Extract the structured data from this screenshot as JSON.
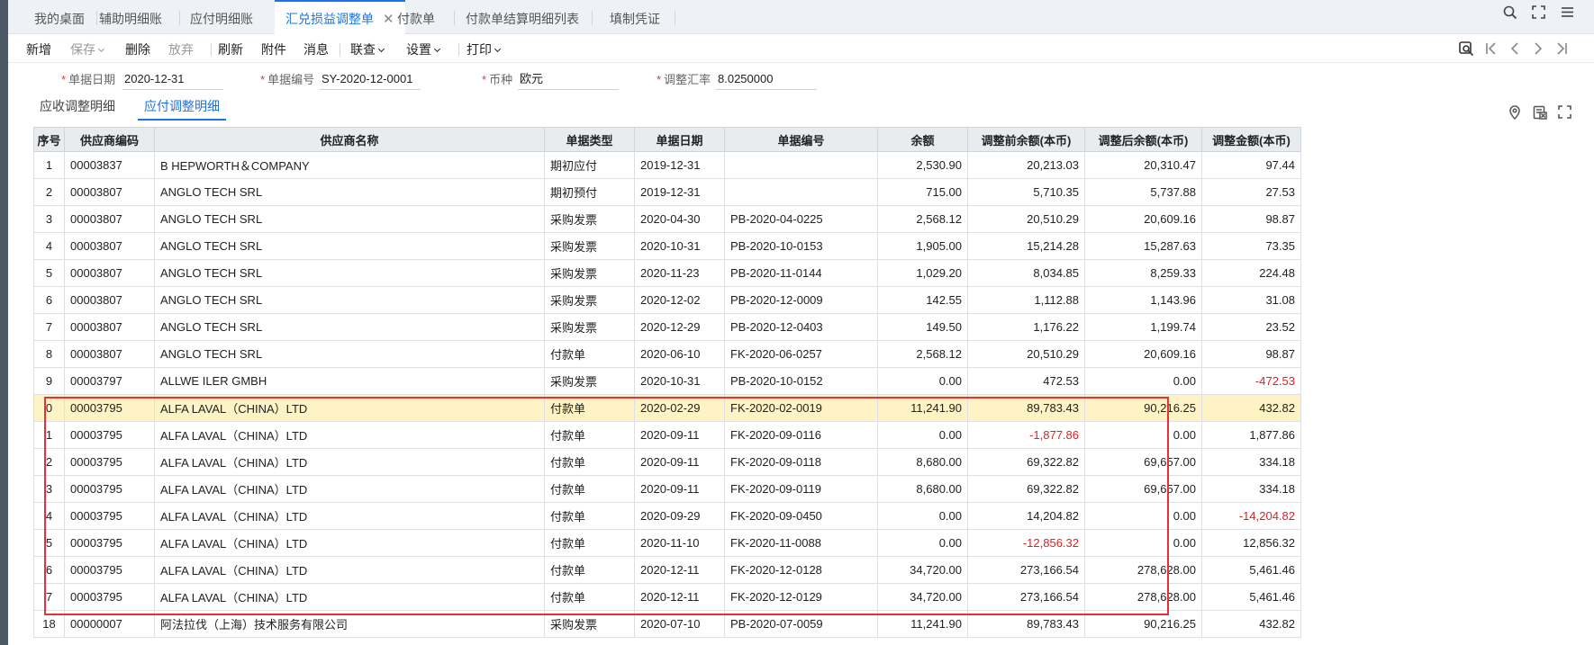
{
  "tabs": [
    {
      "label": "我的桌面"
    },
    {
      "label": "辅助明细账"
    },
    {
      "label": "应付明细账"
    },
    {
      "label": "汇兑损益调整单"
    },
    {
      "label": "付款单"
    },
    {
      "label": "付款单结算明细列表"
    },
    {
      "label": "填制凭证"
    }
  ],
  "toolbar": {
    "new": "新增",
    "save": "保存",
    "delete": "删除",
    "discard": "放弃",
    "refresh": "刷新",
    "attach": "附件",
    "message": "消息",
    "query": "联查",
    "settings": "设置",
    "print": "打印"
  },
  "form": {
    "date_label": "单据日期",
    "date_value": "2020-12-31",
    "no_label": "单据编号",
    "no_value": "SY-2020-12-0001",
    "currency_label": "币种",
    "currency_value": "欧元",
    "rate_label": "调整汇率",
    "rate_value": "8.0250000"
  },
  "subtabs": [
    {
      "label": "应收调整明细"
    },
    {
      "label": "应付调整明细"
    }
  ],
  "table": {
    "headers": [
      "序号",
      "供应商编码",
      "供应商名称",
      "单据类型",
      "单据日期",
      "单据编号",
      "余额",
      "调整前余额(本币)",
      "调整后余额(本币)",
      "调整金额(本币)"
    ],
    "rows": [
      [
        "1",
        "00003837",
        "B HEPWORTH＆COMPANY",
        "期初应付",
        "2019-12-31",
        "",
        "2,530.90",
        "20,213.03",
        "20,310.47",
        "97.44"
      ],
      [
        "2",
        "00003807",
        "ANGLO TECH SRL",
        "期初预付",
        "2019-12-31",
        "",
        "715.00",
        "5,710.35",
        "5,737.88",
        "27.53"
      ],
      [
        "3",
        "00003807",
        "ANGLO TECH SRL",
        "采购发票",
        "2020-04-30",
        "PB-2020-04-0225",
        "2,568.12",
        "20,510.29",
        "20,609.16",
        "98.87"
      ],
      [
        "4",
        "00003807",
        "ANGLO TECH SRL",
        "采购发票",
        "2020-10-31",
        "PB-2020-10-0153",
        "1,905.00",
        "15,214.28",
        "15,287.63",
        "73.35"
      ],
      [
        "5",
        "00003807",
        "ANGLO TECH SRL",
        "采购发票",
        "2020-11-23",
        "PB-2020-11-0144",
        "1,029.20",
        "8,034.85",
        "8,259.33",
        "224.48"
      ],
      [
        "6",
        "00003807",
        "ANGLO TECH SRL",
        "采购发票",
        "2020-12-02",
        "PB-2020-12-0009",
        "142.55",
        "1,112.88",
        "1,143.96",
        "31.08"
      ],
      [
        "7",
        "00003807",
        "ANGLO TECH SRL",
        "采购发票",
        "2020-12-29",
        "PB-2020-12-0403",
        "149.50",
        "1,176.22",
        "1,199.74",
        "23.52"
      ],
      [
        "8",
        "00003807",
        "ANGLO TECH SRL",
        "付款单",
        "2020-06-10",
        "FK-2020-06-0257",
        "2,568.12",
        "20,510.29",
        "20,609.16",
        "98.87"
      ],
      [
        "9",
        "00003797",
        "ALLWE ILER GMBH",
        "采购发票",
        "2020-10-31",
        "PB-2020-10-0152",
        "0.00",
        "472.53",
        "0.00",
        "-472.53"
      ],
      [
        "0",
        "00003795",
        "ALFA LAVAL（CHINA）LTD",
        "付款单",
        "2020-02-29",
        "FK-2020-02-0019",
        "11,241.90",
        "89,783.43",
        "90,216.25",
        "432.82"
      ],
      [
        "1",
        "00003795",
        "ALFA LAVAL（CHINA）LTD",
        "付款单",
        "2020-09-11",
        "FK-2020-09-0116",
        "0.00",
        "-1,877.86",
        "0.00",
        "1,877.86"
      ],
      [
        "2",
        "00003795",
        "ALFA LAVAL（CHINA）LTD",
        "付款单",
        "2020-09-11",
        "FK-2020-09-0118",
        "8,680.00",
        "69,322.82",
        "69,657.00",
        "334.18"
      ],
      [
        "3",
        "00003795",
        "ALFA LAVAL（CHINA）LTD",
        "付款单",
        "2020-09-11",
        "FK-2020-09-0119",
        "8,680.00",
        "69,322.82",
        "69,657.00",
        "334.18"
      ],
      [
        "4",
        "00003795",
        "ALFA LAVAL（CHINA）LTD",
        "付款单",
        "2020-09-29",
        "FK-2020-09-0450",
        "0.00",
        "14,204.82",
        "0.00",
        "-14,204.82"
      ],
      [
        "5",
        "00003795",
        "ALFA LAVAL（CHINA）LTD",
        "付款单",
        "2020-11-10",
        "FK-2020-11-0088",
        "0.00",
        "-12,856.32",
        "0.00",
        "12,856.32"
      ],
      [
        "6",
        "00003795",
        "ALFA LAVAL（CHINA）LTD",
        "付款单",
        "2020-12-11",
        "FK-2020-12-0128",
        "34,720.00",
        "273,166.54",
        "278,628.00",
        "5,461.46"
      ],
      [
        "7",
        "00003795",
        "ALFA LAVAL（CHINA）LTD",
        "付款单",
        "2020-12-11",
        "FK-2020-12-0129",
        "34,720.00",
        "273,166.54",
        "278,628.00",
        "5,461.46"
      ],
      [
        "18",
        "00000007",
        "阿法拉伐（上海）技术服务有限公司",
        "采购发票",
        "2020-07-10",
        "PB-2020-07-0059",
        "11,241.90",
        "89,783.43",
        "90,216.25",
        "432.82"
      ]
    ]
  },
  "colors": {
    "accent": "#1a74e8",
    "negative": "#e02020",
    "highlight_box": "#e8303a",
    "selected_row": "#fdf3c4"
  }
}
